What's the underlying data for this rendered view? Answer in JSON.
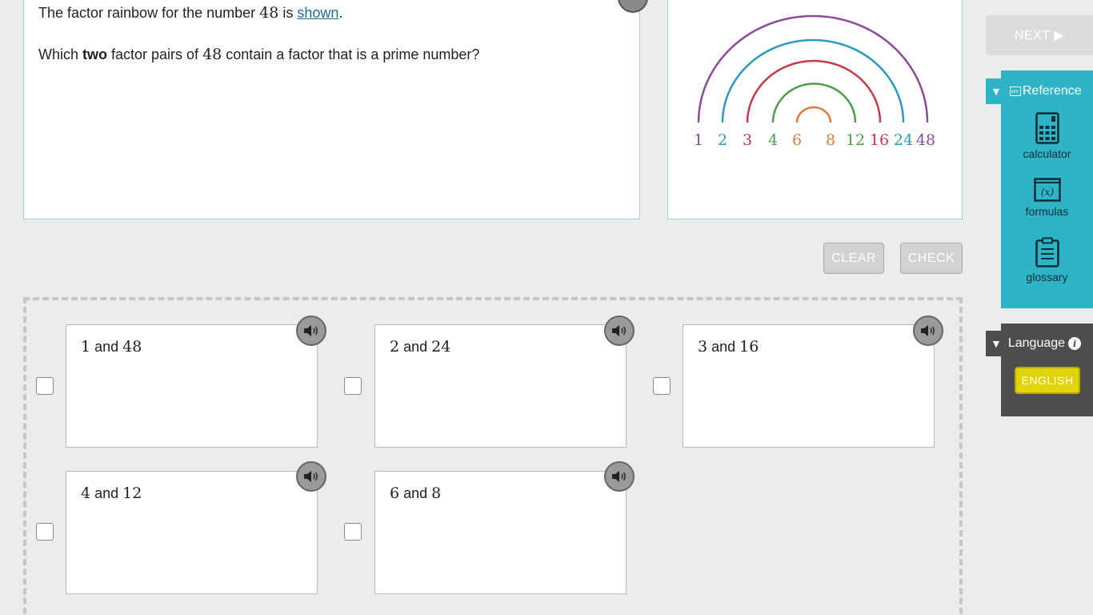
{
  "question": {
    "line1": {
      "pre": "The factor rainbow for the number ",
      "num": "48",
      "mid": " is ",
      "link": "shown",
      "post": "."
    },
    "line2": {
      "pre": "Which ",
      "bold": "two",
      "mid": " factor pairs of ",
      "num": "48",
      "post": " contain a factor that is a prime number?"
    }
  },
  "rainbow": {
    "labels": [
      {
        "text": "1",
        "color": "#8b4a9b"
      },
      {
        "text": "2",
        "color": "#2a9ac2"
      },
      {
        "text": "3",
        "color": "#c63a4a"
      },
      {
        "text": "4",
        "color": "#4a9f4a"
      },
      {
        "text": "6",
        "color": "#e07a3c"
      },
      {
        "text": "8",
        "color": "#e07a3c"
      },
      {
        "text": "12",
        "color": "#4a9f4a"
      },
      {
        "text": "16",
        "color": "#c63a4a"
      },
      {
        "text": "24",
        "color": "#2a9ac2"
      },
      {
        "text": "48",
        "color": "#8b4a9b"
      }
    ]
  },
  "buttons": {
    "clear": "CLEAR",
    "check": "CHECK",
    "next": "NEXT ▶"
  },
  "choices": [
    {
      "a": "1",
      "and": "and",
      "b": "48"
    },
    {
      "a": "2",
      "and": "and",
      "b": "24"
    },
    {
      "a": "3",
      "and": "and",
      "b": "16"
    },
    {
      "a": "4",
      "and": "and",
      "b": "12"
    },
    {
      "a": "6",
      "and": "and",
      "b": "8"
    }
  ],
  "reference": {
    "title": "Reference",
    "tools": [
      "calculator",
      "formulas",
      "glossary"
    ]
  },
  "language": {
    "title": "Language",
    "selected": "ENGLISH"
  },
  "colors": {
    "accent": "#2fb3c6",
    "language_bg": "#4d4d4d",
    "english": "#e1d40a"
  }
}
